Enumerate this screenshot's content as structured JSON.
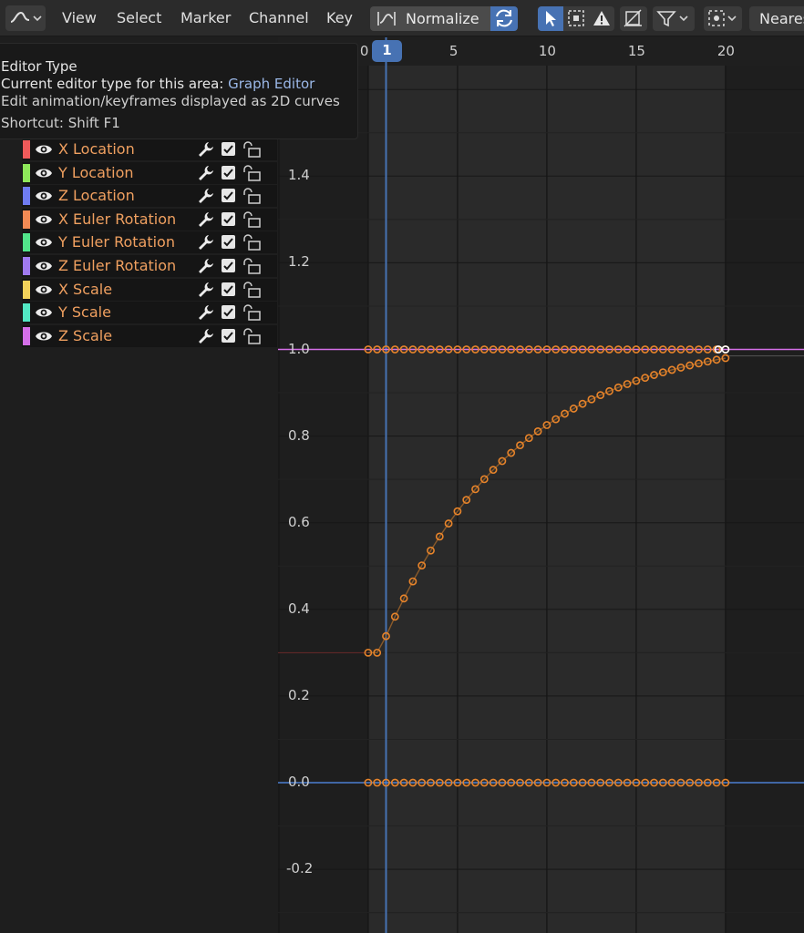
{
  "header": {
    "menus": [
      {
        "id": "view",
        "label": "View"
      },
      {
        "id": "select",
        "label": "Select"
      },
      {
        "id": "marker",
        "label": "Marker"
      },
      {
        "id": "channel",
        "label": "Channel"
      },
      {
        "id": "key",
        "label": "Key"
      }
    ],
    "normalize_label": "Normalize",
    "interpolation_label": "Neares"
  },
  "tooltip": {
    "title": "Editor Type",
    "current_prefix": "Current editor type for this area:",
    "current_value": "Graph Editor",
    "description": "Edit animation/keyframes displayed as 2D curves",
    "shortcut": "Shortcut: Shift F1"
  },
  "channels": [
    {
      "name": "X Location",
      "color": "#f05a5a",
      "selected": true
    },
    {
      "name": "Y Location",
      "color": "#8ee85a",
      "selected": true
    },
    {
      "name": "Z Location",
      "color": "#6f7cf2",
      "selected": true
    },
    {
      "name": "X Euler Rotation",
      "color": "#f28a54",
      "selected": true
    },
    {
      "name": "Y Euler Rotation",
      "color": "#52e58a",
      "selected": true
    },
    {
      "name": "Z Euler Rotation",
      "color": "#a07af0",
      "selected": true
    },
    {
      "name": "X Scale",
      "color": "#f2d25a",
      "selected": true
    },
    {
      "name": "Y Scale",
      "color": "#52e8c4",
      "selected": true
    },
    {
      "name": "Z Scale",
      "color": "#d46fe8",
      "selected": true
    }
  ],
  "timeline": {
    "current_frame": "1",
    "frame_ticks": [
      "0",
      "5",
      "10",
      "15",
      "20"
    ],
    "value_ticks": [
      "1.4",
      "1.2",
      "1.0",
      "0.8",
      "0.6",
      "0.4",
      "0.2",
      "0.0",
      "-0.2"
    ]
  },
  "colors": {
    "accent": "#4772b3",
    "keyframe": "#e8842a",
    "curve_z_scale": "#d46fe8",
    "curve_zero": "#4c7fd0"
  }
}
